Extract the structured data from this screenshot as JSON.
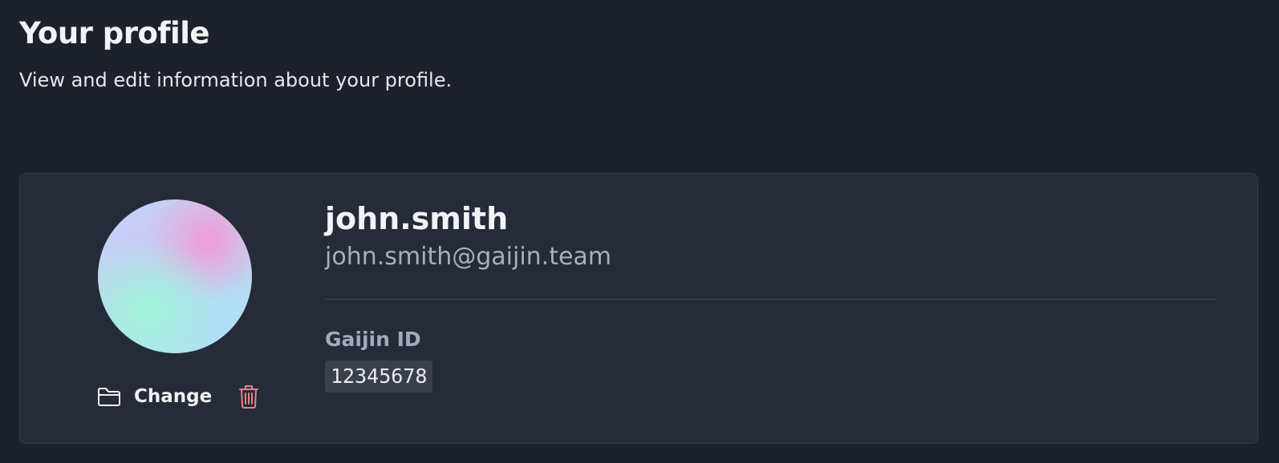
{
  "header": {
    "title": "Your profile",
    "subtitle": "View and edit information about your profile."
  },
  "profile": {
    "avatar_icon": "gradient-avatar",
    "change_label": "Change",
    "change_icon": "folder-icon",
    "delete_icon": "trash-icon",
    "username": "john.smith",
    "email": "john.smith@gaijin.team",
    "id_label": "Gaijin ID",
    "id_value": "12345678"
  },
  "colors": {
    "background": "#1d212c",
    "card": "#262b39",
    "danger": "#e8818b",
    "muted_text": "#a8aebe"
  }
}
